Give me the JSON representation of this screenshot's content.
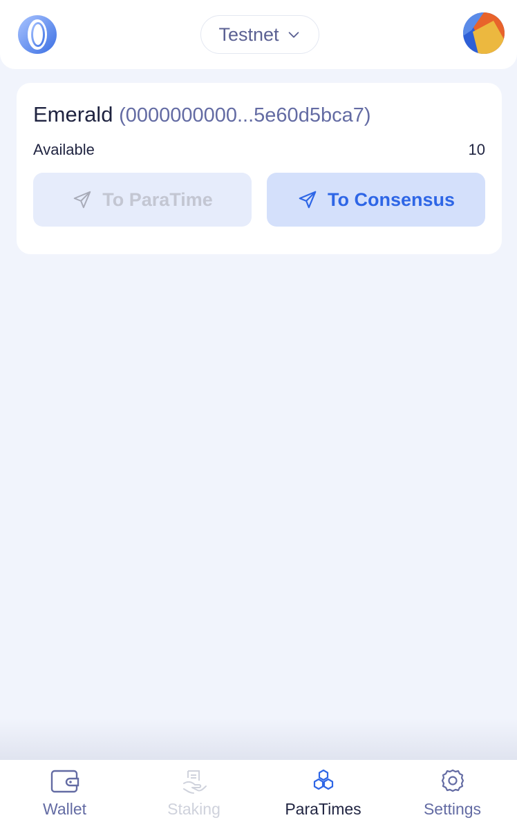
{
  "colors": {
    "accent": "#2e66e6",
    "muted_text": "#636ba3",
    "disabled_text": "#c3c6d2",
    "background": "#f1f4fc"
  },
  "header": {
    "logo_icon": "oasis-logo-icon",
    "network_label": "Testnet",
    "network_icon": "chevron-down-icon",
    "avatar_icon": "account-avatar"
  },
  "paratime_card": {
    "name": "Emerald",
    "address": "(0000000000...5e60d5bca7)",
    "available_label": "Available",
    "available_value": "10",
    "to_paratime_label": "To ParaTime",
    "to_paratime_disabled": true,
    "to_consensus_label": "To Consensus",
    "button_icon": "send-icon"
  },
  "bottom_nav": {
    "items": [
      {
        "label": "Wallet",
        "icon": "wallet-icon",
        "state": "normal"
      },
      {
        "label": "Staking",
        "icon": "staking-icon",
        "state": "disabled"
      },
      {
        "label": "ParaTimes",
        "icon": "paratimes-icon",
        "state": "active"
      },
      {
        "label": "Settings",
        "icon": "gear-icon",
        "state": "normal"
      }
    ]
  }
}
